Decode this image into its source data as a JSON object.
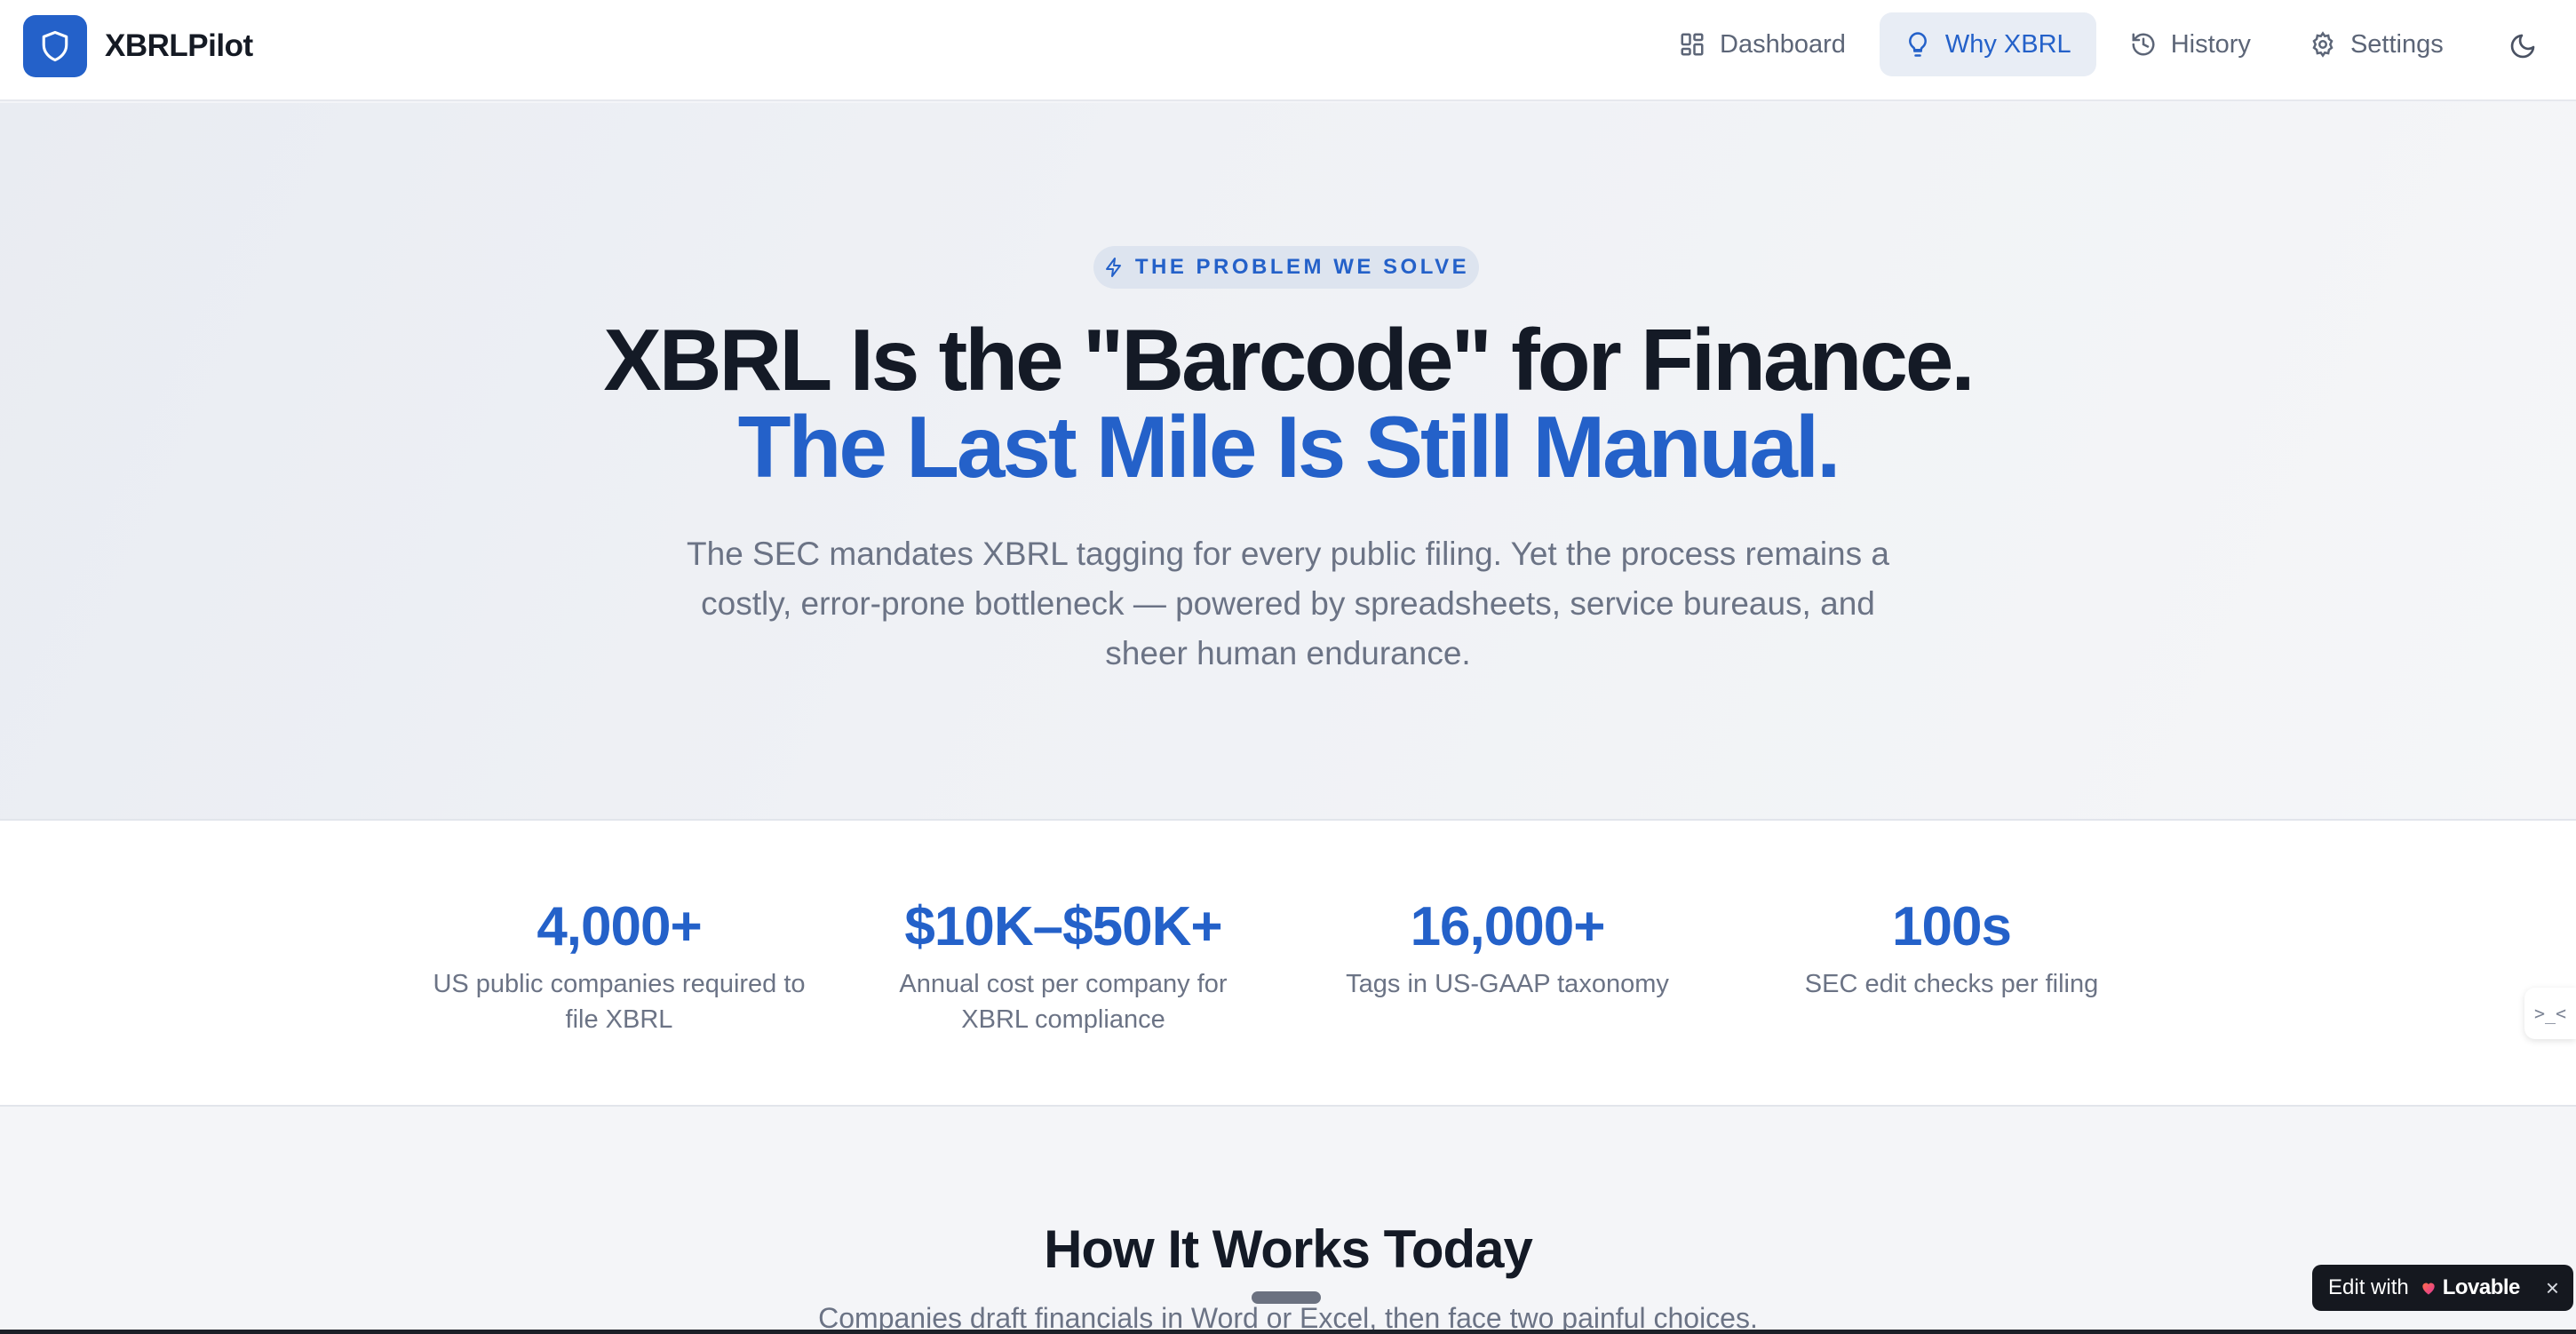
{
  "app": {
    "name": "XBRLPilot"
  },
  "nav": {
    "items": [
      {
        "label": "Dashboard",
        "icon": "layout-grid-icon",
        "active": false
      },
      {
        "label": "Why XBRL",
        "icon": "lightbulb-icon",
        "active": true
      },
      {
        "label": "History",
        "icon": "history-icon",
        "active": false
      },
      {
        "label": "Settings",
        "icon": "gear-icon",
        "active": false
      }
    ],
    "theme_toggle_icon": "moon-icon"
  },
  "hero": {
    "badge": "THE PROBLEM WE SOLVE",
    "headline_line1": "XBRL Is the \"Barcode\" for Finance.",
    "headline_line2": "The Last Mile Is Still Manual.",
    "subtext": "The SEC mandates XBRL tagging for every public filing. Yet the process remains a costly, error-prone bottleneck — powered by spreadsheets, service bureaus, and sheer human endurance."
  },
  "stats": [
    {
      "value": "4,000+",
      "label": "US public companies required to file XBRL"
    },
    {
      "value": "$10K–$50K+",
      "label": "Annual cost per company for XBRL compliance"
    },
    {
      "value": "16,000+",
      "label": "Tags in US-GAAP taxonomy"
    },
    {
      "value": "100s",
      "label": "SEC edit checks per filing"
    }
  ],
  "how": {
    "title": "How It Works Today",
    "subtitle": "Companies draft financials in Word or Excel, then face two painful choices."
  },
  "side_tab": {
    "glyph": ">_<"
  },
  "lovable": {
    "prefix": "Edit with",
    "brand": "Lovable",
    "close": "×"
  },
  "colors": {
    "accent": "#2461c9",
    "text": "#141a26",
    "muted": "#6b7385"
  }
}
